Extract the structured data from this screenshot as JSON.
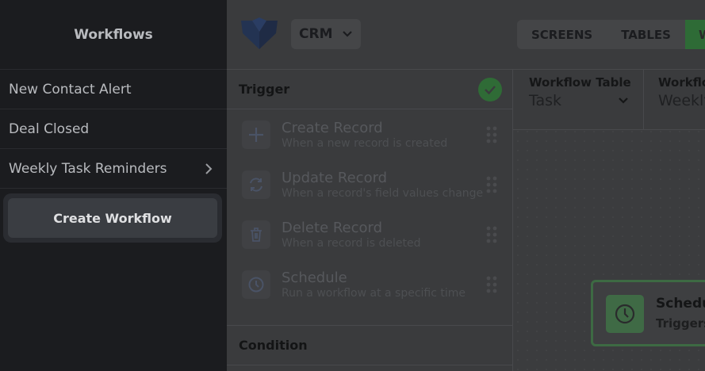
{
  "sidebar": {
    "title": "Workflows",
    "items": [
      {
        "label": "New Contact Alert"
      },
      {
        "label": "Deal Closed"
      },
      {
        "label": "Weekly Task Reminders"
      }
    ],
    "create_label": "Create Workflow"
  },
  "header": {
    "app_name": "CRM",
    "tabs": [
      {
        "label": "SCREENS"
      },
      {
        "label": "TABLES"
      },
      {
        "label": "W"
      }
    ]
  },
  "trigger_panel": {
    "title": "Trigger",
    "items": [
      {
        "title": "Create Record",
        "desc": "When a new record is created",
        "icon": "plus-icon"
      },
      {
        "title": "Update Record",
        "desc": "When a record's field values change",
        "icon": "refresh-icon"
      },
      {
        "title": "Delete Record",
        "desc": "When a record is deleted",
        "icon": "trash-icon"
      },
      {
        "title": "Schedule",
        "desc": "Run a workflow at a specific time",
        "icon": "clock-icon"
      }
    ],
    "condition_title": "Condition"
  },
  "canvas": {
    "workflow_table_label": "Workflow Table",
    "workflow_table_value": "Task",
    "workflow_name_label": "Workflo",
    "workflow_name_value": "Weekly",
    "node_title": "Schedu",
    "node_subtitle": "Triggers"
  },
  "colors": {
    "accent_green": "#2e6b36",
    "sidebar_bg": "#1b1c1f"
  }
}
